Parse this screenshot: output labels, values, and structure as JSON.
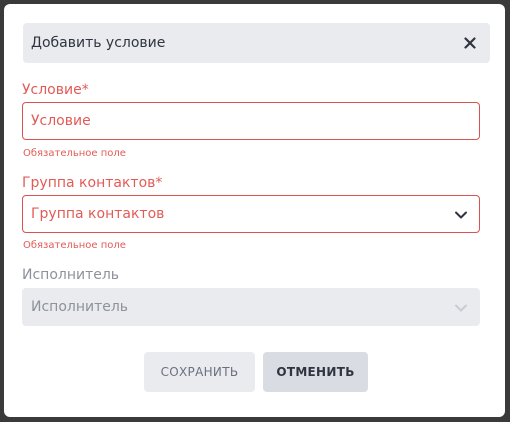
{
  "dialog": {
    "title": "Добавить условие",
    "close_icon": "close-icon"
  },
  "fields": {
    "condition": {
      "label": "Условие*",
      "placeholder": "Условие",
      "error": "Обязательное поле"
    },
    "contact_group": {
      "label": "Группа контактов*",
      "value": "Группа контактов",
      "error": "Обязательное поле",
      "icon": "chevron-down-icon"
    },
    "executor": {
      "label": "Исполнитель",
      "value": "Исполнитель",
      "icon": "chevron-down-icon",
      "disabled": true
    }
  },
  "buttons": {
    "save_label": "СОХРАНИТЬ",
    "cancel_label": "ОТМЕНИТЬ"
  },
  "colors": {
    "error": "#e35b55",
    "header_bg": "#e9ebef",
    "disabled_text": "#8d929b",
    "backdrop": "#3a3a3a"
  }
}
